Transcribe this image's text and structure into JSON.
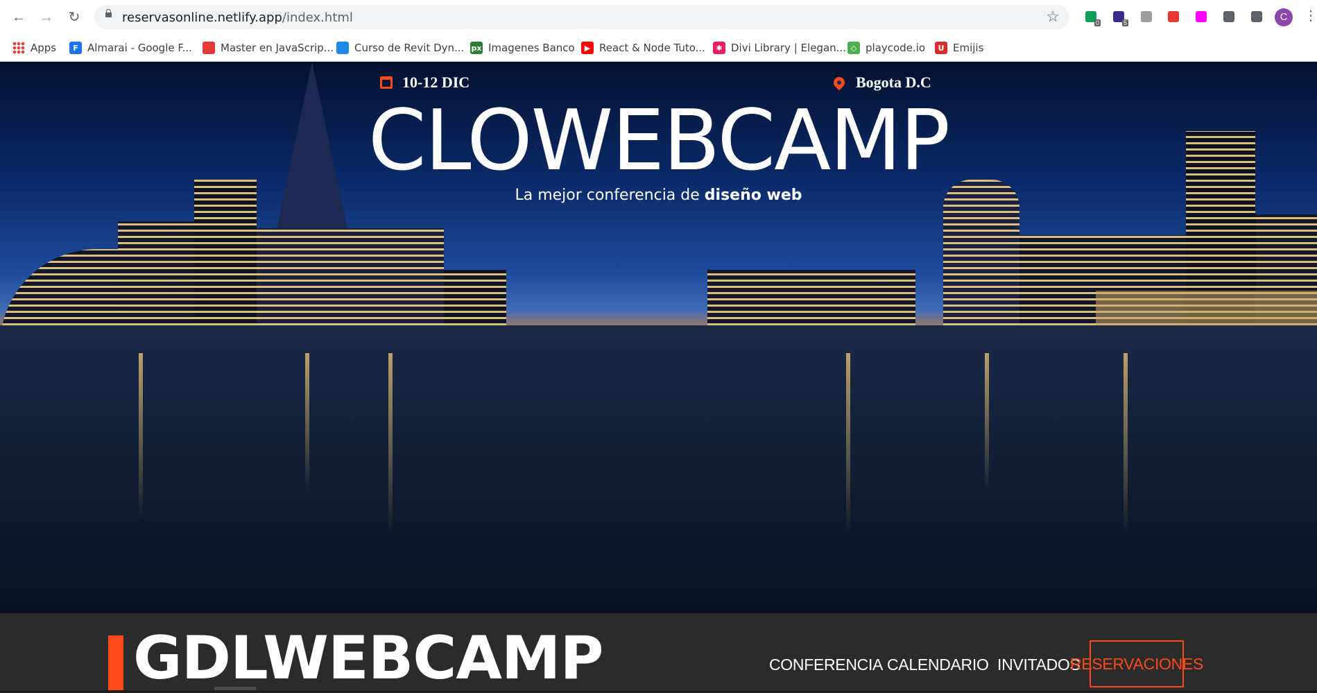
{
  "browser": {
    "url_host": "reservasonline.netlify.app",
    "url_path": "/index.html",
    "bookmarks": [
      {
        "label": "Apps",
        "color": "#ea4335",
        "icon": "apps-grid-icon"
      },
      {
        "label": "Almarai - Google F...",
        "color": "#1a73e8",
        "icon": "google-fonts-icon",
        "glyph": "F"
      },
      {
        "label": "Master en JavaScrip...",
        "color": "#e53935",
        "icon": "udemy-icon"
      },
      {
        "label": "Curso de Revit Dyn...",
        "color": "#1e88e5",
        "icon": "dynamo-icon"
      },
      {
        "label": "Imagenes Banco",
        "color": "#2e7d32",
        "icon": "pexels-icon",
        "glyph": "px"
      },
      {
        "label": "React & Node Tuto...",
        "color": "#ff0000",
        "icon": "youtube-icon",
        "glyph": "▶"
      },
      {
        "label": "Divi Library | Elegan...",
        "color": "#e91e63",
        "icon": "divi-icon",
        "glyph": "✱"
      },
      {
        "label": "playcode.io",
        "color": "#4caf50",
        "icon": "playcode-icon",
        "glyph": "◇"
      },
      {
        "label": "Emijis",
        "color": "#d32f2f",
        "icon": "emojis-icon",
        "glyph": "U"
      }
    ],
    "extensions": [
      {
        "icon": "shield-check-icon",
        "badge": "0",
        "color": "#0f9d58"
      },
      {
        "icon": "cube-icon",
        "badge": "5",
        "color": "#3c2a8a"
      },
      {
        "icon": "drive-icon",
        "badge": "",
        "color": "#9e9e9e"
      },
      {
        "icon": "color-wheel-icon",
        "badge": "",
        "color": "#e53935"
      },
      {
        "icon": "color-grid-icon",
        "badge": "",
        "color": "#ff00ff"
      },
      {
        "icon": "puzzle-extensions-icon",
        "badge": "",
        "color": "#5f6368"
      },
      {
        "icon": "reading-list-icon",
        "badge": "",
        "color": "#5f6368"
      }
    ],
    "profile_initial": "C"
  },
  "hero": {
    "date": "10-12 DIC",
    "location": "Bogota D.C",
    "title": "CLOWEBCAMP",
    "subtitle_prefix": "La mejor conferencia de",
    "subtitle_bold": "diseño web"
  },
  "site": {
    "logo": "GDLWEBCAMP",
    "menu": [
      "CONFERENCIA",
      "CALENDARIO",
      "INVITADOS"
    ],
    "cta": "RESERVACIONES",
    "accent_color": "#fe4918"
  }
}
